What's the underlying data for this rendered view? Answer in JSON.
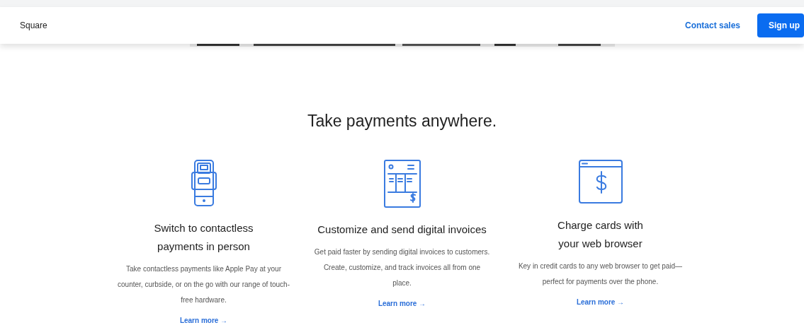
{
  "navbar": {
    "brand": "Square",
    "links": [
      {
        "label": "Contact sales",
        "kind": "link"
      },
      {
        "label": "Sign up",
        "kind": "button"
      }
    ]
  },
  "heading": "Take payments anywhere.",
  "features": [
    {
      "title_lines": [
        "Switch to contactless",
        "payments in person"
      ],
      "text": "Take contactless payments like Apple Pay at your counter, curbside, or on the go with our range of touch-free hardware.",
      "link": "Learn more →"
    },
    {
      "title_lines": [
        "Customize and send digital invoices"
      ],
      "text": "Get paid faster by sending digital invoices to customers. Create, customize, and track invoices all from one place.",
      "link": "Learn more →"
    },
    {
      "title_lines": [
        "Charge cards with",
        "your web browser"
      ],
      "text": "Key in credit cards to any web browser to get paid—perfect for payments over the phone.",
      "link": "Learn more →"
    }
  ]
}
